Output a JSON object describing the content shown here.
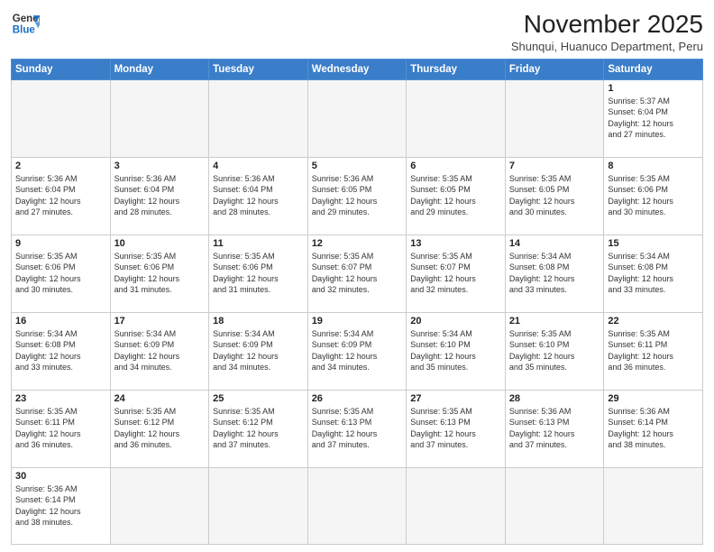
{
  "header": {
    "logo_line1": "General",
    "logo_line2": "Blue",
    "title": "November 2025",
    "subtitle": "Shunqui, Huanuco Department, Peru"
  },
  "days_of_week": [
    "Sunday",
    "Monday",
    "Tuesday",
    "Wednesday",
    "Thursday",
    "Friday",
    "Saturday"
  ],
  "weeks": [
    [
      {
        "day": "",
        "info": ""
      },
      {
        "day": "",
        "info": ""
      },
      {
        "day": "",
        "info": ""
      },
      {
        "day": "",
        "info": ""
      },
      {
        "day": "",
        "info": ""
      },
      {
        "day": "",
        "info": ""
      },
      {
        "day": "1",
        "info": "Sunrise: 5:37 AM\nSunset: 6:04 PM\nDaylight: 12 hours\nand 27 minutes."
      }
    ],
    [
      {
        "day": "2",
        "info": "Sunrise: 5:36 AM\nSunset: 6:04 PM\nDaylight: 12 hours\nand 27 minutes."
      },
      {
        "day": "3",
        "info": "Sunrise: 5:36 AM\nSunset: 6:04 PM\nDaylight: 12 hours\nand 28 minutes."
      },
      {
        "day": "4",
        "info": "Sunrise: 5:36 AM\nSunset: 6:04 PM\nDaylight: 12 hours\nand 28 minutes."
      },
      {
        "day": "5",
        "info": "Sunrise: 5:36 AM\nSunset: 6:05 PM\nDaylight: 12 hours\nand 29 minutes."
      },
      {
        "day": "6",
        "info": "Sunrise: 5:35 AM\nSunset: 6:05 PM\nDaylight: 12 hours\nand 29 minutes."
      },
      {
        "day": "7",
        "info": "Sunrise: 5:35 AM\nSunset: 6:05 PM\nDaylight: 12 hours\nand 30 minutes."
      },
      {
        "day": "8",
        "info": "Sunrise: 5:35 AM\nSunset: 6:06 PM\nDaylight: 12 hours\nand 30 minutes."
      }
    ],
    [
      {
        "day": "9",
        "info": "Sunrise: 5:35 AM\nSunset: 6:06 PM\nDaylight: 12 hours\nand 30 minutes."
      },
      {
        "day": "10",
        "info": "Sunrise: 5:35 AM\nSunset: 6:06 PM\nDaylight: 12 hours\nand 31 minutes."
      },
      {
        "day": "11",
        "info": "Sunrise: 5:35 AM\nSunset: 6:06 PM\nDaylight: 12 hours\nand 31 minutes."
      },
      {
        "day": "12",
        "info": "Sunrise: 5:35 AM\nSunset: 6:07 PM\nDaylight: 12 hours\nand 32 minutes."
      },
      {
        "day": "13",
        "info": "Sunrise: 5:35 AM\nSunset: 6:07 PM\nDaylight: 12 hours\nand 32 minutes."
      },
      {
        "day": "14",
        "info": "Sunrise: 5:34 AM\nSunset: 6:08 PM\nDaylight: 12 hours\nand 33 minutes."
      },
      {
        "day": "15",
        "info": "Sunrise: 5:34 AM\nSunset: 6:08 PM\nDaylight: 12 hours\nand 33 minutes."
      }
    ],
    [
      {
        "day": "16",
        "info": "Sunrise: 5:34 AM\nSunset: 6:08 PM\nDaylight: 12 hours\nand 33 minutes."
      },
      {
        "day": "17",
        "info": "Sunrise: 5:34 AM\nSunset: 6:09 PM\nDaylight: 12 hours\nand 34 minutes."
      },
      {
        "day": "18",
        "info": "Sunrise: 5:34 AM\nSunset: 6:09 PM\nDaylight: 12 hours\nand 34 minutes."
      },
      {
        "day": "19",
        "info": "Sunrise: 5:34 AM\nSunset: 6:09 PM\nDaylight: 12 hours\nand 34 minutes."
      },
      {
        "day": "20",
        "info": "Sunrise: 5:34 AM\nSunset: 6:10 PM\nDaylight: 12 hours\nand 35 minutes."
      },
      {
        "day": "21",
        "info": "Sunrise: 5:35 AM\nSunset: 6:10 PM\nDaylight: 12 hours\nand 35 minutes."
      },
      {
        "day": "22",
        "info": "Sunrise: 5:35 AM\nSunset: 6:11 PM\nDaylight: 12 hours\nand 36 minutes."
      }
    ],
    [
      {
        "day": "23",
        "info": "Sunrise: 5:35 AM\nSunset: 6:11 PM\nDaylight: 12 hours\nand 36 minutes."
      },
      {
        "day": "24",
        "info": "Sunrise: 5:35 AM\nSunset: 6:12 PM\nDaylight: 12 hours\nand 36 minutes."
      },
      {
        "day": "25",
        "info": "Sunrise: 5:35 AM\nSunset: 6:12 PM\nDaylight: 12 hours\nand 37 minutes."
      },
      {
        "day": "26",
        "info": "Sunrise: 5:35 AM\nSunset: 6:13 PM\nDaylight: 12 hours\nand 37 minutes."
      },
      {
        "day": "27",
        "info": "Sunrise: 5:35 AM\nSunset: 6:13 PM\nDaylight: 12 hours\nand 37 minutes."
      },
      {
        "day": "28",
        "info": "Sunrise: 5:36 AM\nSunset: 6:13 PM\nDaylight: 12 hours\nand 37 minutes."
      },
      {
        "day": "29",
        "info": "Sunrise: 5:36 AM\nSunset: 6:14 PM\nDaylight: 12 hours\nand 38 minutes."
      }
    ],
    [
      {
        "day": "30",
        "info": "Sunrise: 5:36 AM\nSunset: 6:14 PM\nDaylight: 12 hours\nand 38 minutes."
      },
      {
        "day": "",
        "info": ""
      },
      {
        "day": "",
        "info": ""
      },
      {
        "day": "",
        "info": ""
      },
      {
        "day": "",
        "info": ""
      },
      {
        "day": "",
        "info": ""
      },
      {
        "day": "",
        "info": ""
      }
    ]
  ]
}
